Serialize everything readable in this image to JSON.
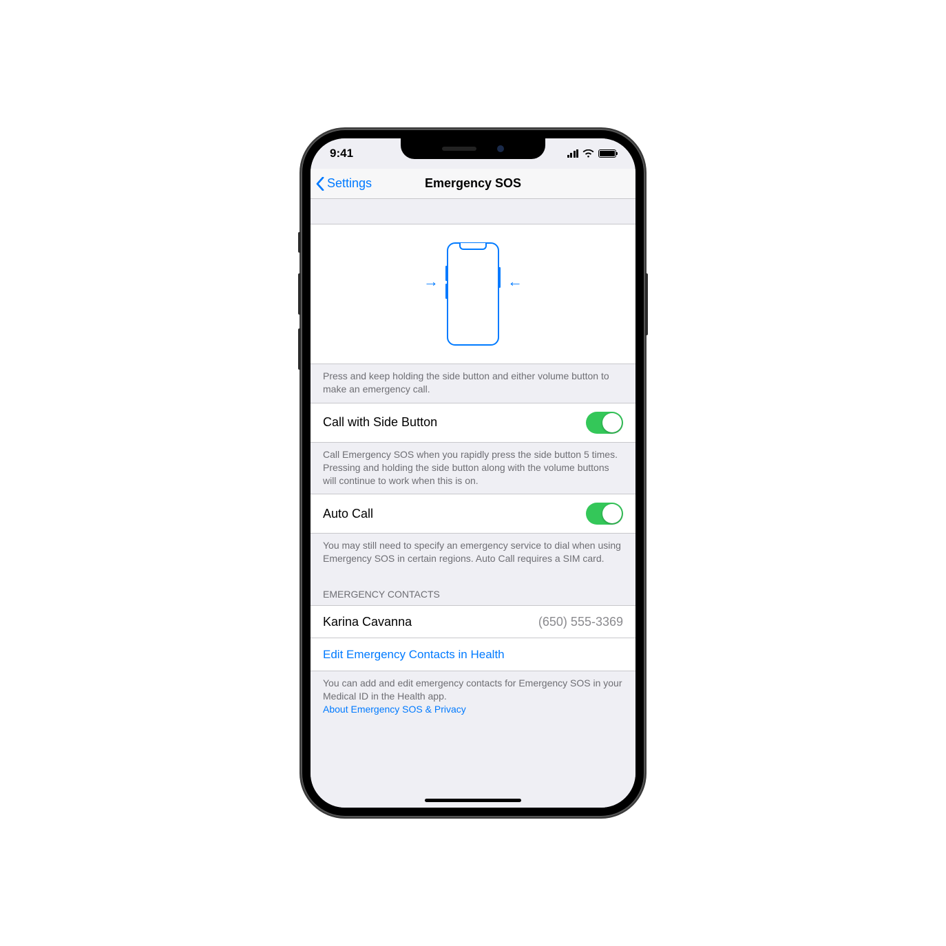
{
  "status": {
    "time": "9:41"
  },
  "nav": {
    "back": "Settings",
    "title": "Emergency SOS"
  },
  "hero": {
    "footer": "Press and keep holding the side button and either volume button to make an emergency call."
  },
  "settings": {
    "call_side": {
      "label": "Call with Side Button",
      "footer": "Call Emergency SOS when you rapidly press the side button 5 times. Pressing and holding the side button along with the volume buttons will continue to work when this is on."
    },
    "auto_call": {
      "label": "Auto Call",
      "footer": "You may still need to specify an emergency service to dial when using Emergency SOS in certain regions. Auto Call requires a SIM card."
    }
  },
  "contacts": {
    "header": "EMERGENCY CONTACTS",
    "items": [
      {
        "name": "Karina Cavanna",
        "phone": "(650) 555-3369"
      }
    ],
    "edit": "Edit Emergency Contacts in Health",
    "footer": "You can add and edit emergency contacts for Emergency SOS in your Medical ID in the Health app.",
    "about": "About Emergency SOS & Privacy"
  }
}
